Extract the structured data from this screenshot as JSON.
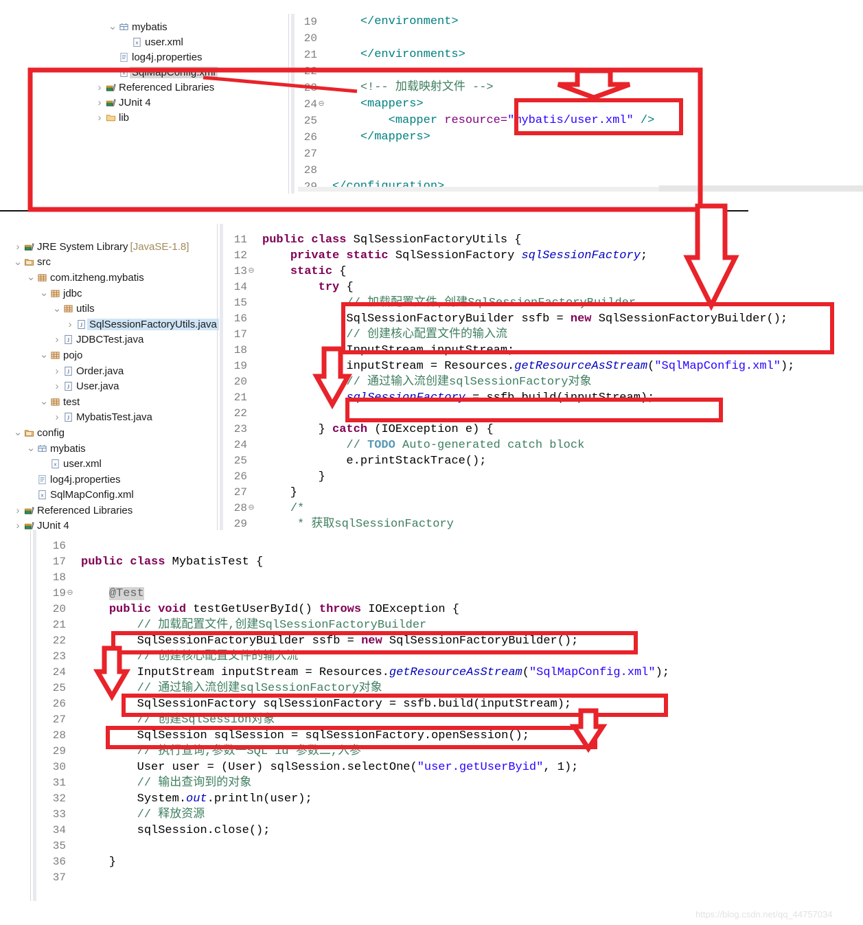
{
  "watermark": "https://blog.csdn.net/qq_44757034",
  "accent_red": "#e8232a",
  "panels": {
    "top": {
      "tree": [
        {
          "indent": 3,
          "twist": "v",
          "icon": "package-folder-icon",
          "label": "mybatis",
          "state": "none"
        },
        {
          "indent": 4,
          "twist": "",
          "icon": "xml-file-icon",
          "label": "user.xml",
          "state": "none"
        },
        {
          "indent": 3,
          "twist": "",
          "icon": "properties-file-icon",
          "label": "log4j.properties",
          "state": "none"
        },
        {
          "indent": 3,
          "twist": "",
          "icon": "xml-file-icon",
          "label": "SqlMapConfig.xml",
          "state": "selected-gray"
        },
        {
          "indent": 2,
          "twist": ">",
          "icon": "library-icon",
          "label": "Referenced Libraries",
          "state": "none"
        },
        {
          "indent": 2,
          "twist": ">",
          "icon": "library-icon",
          "label": "JUnit 4",
          "state": "none"
        },
        {
          "indent": 2,
          "twist": ">",
          "icon": "folder-icon",
          "label": "lib",
          "state": "none"
        }
      ],
      "code": [
        {
          "n": "19",
          "fold": "",
          "tokens": [
            {
              "t": "    ",
              "c": "plain"
            },
            {
              "t": "</environment>",
              "c": "tag"
            }
          ]
        },
        {
          "n": "20",
          "fold": "",
          "tokens": []
        },
        {
          "n": "21",
          "fold": "",
          "tokens": [
            {
              "t": "    ",
              "c": "plain"
            },
            {
              "t": "</environments>",
              "c": "tag"
            }
          ]
        },
        {
          "n": "22",
          "fold": "",
          "tokens": []
        },
        {
          "n": "23",
          "fold": "",
          "tokens": [
            {
              "t": "    ",
              "c": "plain"
            },
            {
              "t": "<!-- 加载映射文件 -->",
              "c": "cmt"
            }
          ]
        },
        {
          "n": "24",
          "fold": "⊖",
          "tokens": [
            {
              "t": "    ",
              "c": "plain"
            },
            {
              "t": "<mappers>",
              "c": "tag"
            }
          ]
        },
        {
          "n": "25",
          "fold": "",
          "tokens": [
            {
              "t": "        ",
              "c": "plain"
            },
            {
              "t": "<mapper ",
              "c": "tag"
            },
            {
              "t": "resource=",
              "c": "attr"
            },
            {
              "t": "\"mybatis/user.xml\"",
              "c": "str"
            },
            {
              "t": " />",
              "c": "tag"
            }
          ]
        },
        {
          "n": "26",
          "fold": "",
          "tokens": [
            {
              "t": "    ",
              "c": "plain"
            },
            {
              "t": "</mappers>",
              "c": "tag"
            }
          ]
        },
        {
          "n": "27",
          "fold": "",
          "tokens": []
        },
        {
          "n": "28",
          "fold": "",
          "tokens": []
        },
        {
          "n": "29",
          "fold": "",
          "tokens": [
            {
              "t": "</configuration>",
              "c": "tag"
            }
          ]
        }
      ]
    },
    "middle": {
      "tree": [
        {
          "indent": 1,
          "twist": ">",
          "icon": "library-icon",
          "label": "JRE System Library ",
          "suffix": "[JavaSE-1.8]",
          "state": "none"
        },
        {
          "indent": 1,
          "twist": "v",
          "icon": "source-folder-icon",
          "label": "src",
          "state": "none"
        },
        {
          "indent": 2,
          "twist": "v",
          "icon": "package-icon",
          "label": "com.itzheng.mybatis",
          "state": "none"
        },
        {
          "indent": 3,
          "twist": "v",
          "icon": "package-icon",
          "label": "jdbc",
          "state": "none"
        },
        {
          "indent": 4,
          "twist": "v",
          "icon": "package-icon",
          "label": "utils",
          "state": "none"
        },
        {
          "indent": 5,
          "twist": ">",
          "icon": "java-file-icon",
          "label": "SqlSessionFactoryUtils.java",
          "state": "selected-blue"
        },
        {
          "indent": 4,
          "twist": ">",
          "icon": "java-file-icon",
          "label": "JDBCTest.java",
          "state": "none"
        },
        {
          "indent": 3,
          "twist": "v",
          "icon": "package-icon",
          "label": "pojo",
          "state": "none"
        },
        {
          "indent": 4,
          "twist": ">",
          "icon": "java-file-icon",
          "label": "Order.java",
          "state": "none"
        },
        {
          "indent": 4,
          "twist": ">",
          "icon": "java-file-icon",
          "label": "User.java",
          "state": "none"
        },
        {
          "indent": 3,
          "twist": "v",
          "icon": "package-icon",
          "label": "test",
          "state": "none"
        },
        {
          "indent": 4,
          "twist": ">",
          "icon": "java-file-icon",
          "label": "MybatisTest.java",
          "state": "none"
        },
        {
          "indent": 1,
          "twist": "v",
          "icon": "source-folder-icon",
          "label": "config",
          "state": "none"
        },
        {
          "indent": 2,
          "twist": "v",
          "icon": "package-folder-icon",
          "label": "mybatis",
          "state": "none"
        },
        {
          "indent": 3,
          "twist": "",
          "icon": "xml-file-icon",
          "label": "user.xml",
          "state": "none"
        },
        {
          "indent": 2,
          "twist": "",
          "icon": "properties-file-icon",
          "label": "log4j.properties",
          "state": "none"
        },
        {
          "indent": 2,
          "twist": "",
          "icon": "xml-file-icon",
          "label": "SqlMapConfig.xml",
          "state": "none"
        },
        {
          "indent": 1,
          "twist": ">",
          "icon": "library-icon",
          "label": "Referenced Libraries",
          "state": "none"
        },
        {
          "indent": 1,
          "twist": ">",
          "icon": "library-icon",
          "label": "JUnit 4",
          "state": "none"
        }
      ],
      "code": [
        {
          "n": "11",
          "fold": "",
          "tokens": [
            {
              "t": "public class ",
              "c": "kw"
            },
            {
              "t": "SqlSessionFactoryUtils",
              "c": "plain"
            },
            {
              "t": " {",
              "c": "plain"
            }
          ]
        },
        {
          "n": "12",
          "fold": "",
          "tokens": [
            {
              "t": "    ",
              "c": "plain"
            },
            {
              "t": "private static ",
              "c": "kw"
            },
            {
              "t": "SqlSessionFactory ",
              "c": "plain"
            },
            {
              "t": "sqlSessionFactory",
              "c": "stat"
            },
            {
              "t": ";",
              "c": "plain"
            }
          ]
        },
        {
          "n": "13",
          "fold": "⊖",
          "tokens": [
            {
              "t": "    ",
              "c": "plain"
            },
            {
              "t": "static ",
              "c": "kw"
            },
            {
              "t": "{",
              "c": "plain"
            }
          ]
        },
        {
          "n": "14",
          "fold": "",
          "tokens": [
            {
              "t": "        ",
              "c": "plain"
            },
            {
              "t": "try ",
              "c": "kw"
            },
            {
              "t": "{",
              "c": "plain"
            }
          ]
        },
        {
          "n": "15",
          "fold": "",
          "tokens": [
            {
              "t": "            // 加载配置文件,创建SqlSessionFactoryBuilder",
              "c": "cmt"
            }
          ]
        },
        {
          "n": "16",
          "fold": "",
          "tokens": [
            {
              "t": "            ",
              "c": "plain"
            },
            {
              "t": "SqlSessionFactoryBuilder ssfb = ",
              "c": "plain"
            },
            {
              "t": "new ",
              "c": "kw"
            },
            {
              "t": "SqlSessionFactoryBuilder();",
              "c": "plain"
            }
          ]
        },
        {
          "n": "17",
          "fold": "",
          "tokens": [
            {
              "t": "            // 创建核心配置文件的输入流",
              "c": "cmt"
            }
          ]
        },
        {
          "n": "18",
          "fold": "",
          "tokens": [
            {
              "t": "            ",
              "c": "plain"
            },
            {
              "t": "InputStream inputStream;",
              "c": "plain"
            }
          ]
        },
        {
          "n": "19",
          "fold": "",
          "tokens": [
            {
              "t": "            ",
              "c": "plain"
            },
            {
              "t": "inputStream = Resources.",
              "c": "plain"
            },
            {
              "t": "getResourceAsStream",
              "c": "stat"
            },
            {
              "t": "(",
              "c": "plain"
            },
            {
              "t": "\"SqlMapConfig.xml\"",
              "c": "str"
            },
            {
              "t": ");",
              "c": "plain"
            }
          ]
        },
        {
          "n": "20",
          "fold": "",
          "tokens": [
            {
              "t": "            // 通过输入流创建sqlSessionFactory对象",
              "c": "cmt"
            }
          ]
        },
        {
          "n": "21",
          "fold": "",
          "tokens": [
            {
              "t": "            ",
              "c": "plain"
            },
            {
              "t": "sqlSessionFactory",
              "c": "stat"
            },
            {
              "t": " = ssfb.build(inputStream);",
              "c": "plain"
            }
          ]
        },
        {
          "n": "22",
          "fold": "",
          "tokens": []
        },
        {
          "n": "23",
          "fold": "",
          "tokens": [
            {
              "t": "        } ",
              "c": "plain"
            },
            {
              "t": "catch ",
              "c": "kw"
            },
            {
              "t": "(IOException e) {",
              "c": "plain"
            }
          ]
        },
        {
          "n": "24",
          "fold": "",
          "tokens": [
            {
              "t": "            ",
              "c": "plain"
            },
            {
              "t": "// ",
              "c": "cmt"
            },
            {
              "t": "TODO",
              "c": "todo"
            },
            {
              "t": " Auto-generated catch block",
              "c": "cmt"
            }
          ]
        },
        {
          "n": "25",
          "fold": "",
          "tokens": [
            {
              "t": "            ",
              "c": "plain"
            },
            {
              "t": "e.printStackTrace();",
              "c": "plain"
            }
          ]
        },
        {
          "n": "26",
          "fold": "",
          "tokens": [
            {
              "t": "        }",
              "c": "plain"
            }
          ]
        },
        {
          "n": "27",
          "fold": "",
          "tokens": [
            {
              "t": "    }",
              "c": "plain"
            }
          ]
        },
        {
          "n": "28",
          "fold": "⊖",
          "tokens": [
            {
              "t": "    ",
              "c": "plain"
            },
            {
              "t": "/*",
              "c": "cmt"
            }
          ]
        },
        {
          "n": "29",
          "fold": "",
          "tokens": [
            {
              "t": "     * 获取sqlSessionFactory",
              "c": "cmt"
            }
          ]
        }
      ]
    },
    "bottom": {
      "code": [
        {
          "n": "16",
          "fold": "",
          "tokens": []
        },
        {
          "n": "17",
          "fold": "",
          "tokens": [
            {
              "t": "public class ",
              "c": "kw"
            },
            {
              "t": "MybatisTest",
              "c": "plain"
            },
            {
              "t": " {",
              "c": "plain"
            }
          ]
        },
        {
          "n": "18",
          "fold": "",
          "tokens": []
        },
        {
          "n": "19",
          "fold": "⊖",
          "tokens": [
            {
              "t": "    ",
              "c": "plain"
            },
            {
              "t": "@Test",
              "c": "anno"
            }
          ]
        },
        {
          "n": "20",
          "fold": "",
          "tokens": [
            {
              "t": "    ",
              "c": "plain"
            },
            {
              "t": "public void ",
              "c": "kw"
            },
            {
              "t": "testGetUserById",
              "c": "plain"
            },
            {
              "t": "() ",
              "c": "plain"
            },
            {
              "t": "throws ",
              "c": "kw"
            },
            {
              "t": "IOException {",
              "c": "plain"
            }
          ]
        },
        {
          "n": "21",
          "fold": "",
          "tokens": [
            {
              "t": "        // 加载配置文件,创建SqlSessionFactoryBuilder",
              "c": "cmt"
            }
          ]
        },
        {
          "n": "22",
          "fold": "",
          "tokens": [
            {
              "t": "        ",
              "c": "plain"
            },
            {
              "t": "SqlSessionFactoryBuilder ssfb = ",
              "c": "plain"
            },
            {
              "t": "new ",
              "c": "kw"
            },
            {
              "t": "SqlSessionFactoryBuilder();",
              "c": "plain"
            }
          ]
        },
        {
          "n": "23",
          "fold": "",
          "tokens": [
            {
              "t": "        // 创建核心配置文件的输入流",
              "c": "cmt"
            }
          ]
        },
        {
          "n": "24",
          "fold": "",
          "tokens": [
            {
              "t": "        ",
              "c": "plain"
            },
            {
              "t": "InputStream inputStream = Resources.",
              "c": "plain"
            },
            {
              "t": "getResourceAsStream",
              "c": "stat"
            },
            {
              "t": "(",
              "c": "plain"
            },
            {
              "t": "\"SqlMapConfig.xml\"",
              "c": "str"
            },
            {
              "t": ");",
              "c": "plain"
            }
          ]
        },
        {
          "n": "25",
          "fold": "",
          "tokens": [
            {
              "t": "        // 通过输入流创建sqlSessionFactory对象",
              "c": "cmt"
            }
          ]
        },
        {
          "n": "26",
          "fold": "",
          "tokens": [
            {
              "t": "        ",
              "c": "plain"
            },
            {
              "t": "SqlSessionFactory sqlSessionFactory = ssfb.build(inputStream);",
              "c": "plain"
            }
          ]
        },
        {
          "n": "27",
          "fold": "",
          "tokens": [
            {
              "t": "        // 创建SqlSession对象",
              "c": "cmt"
            }
          ]
        },
        {
          "n": "28",
          "fold": "",
          "tokens": [
            {
              "t": "        ",
              "c": "plain"
            },
            {
              "t": "SqlSession sqlSession = sqlSessionFactory.openSession();",
              "c": "plain"
            }
          ]
        },
        {
          "n": "29",
          "fold": "",
          "tokens": [
            {
              "t": "        // 执行查询,参数一SQL id 参数二,入参",
              "c": "cmt"
            }
          ]
        },
        {
          "n": "30",
          "fold": "",
          "tokens": [
            {
              "t": "        ",
              "c": "plain"
            },
            {
              "t": "User user = (User) sqlSession.selectOne(",
              "c": "plain"
            },
            {
              "t": "\"user.getUserByid\"",
              "c": "str"
            },
            {
              "t": ", 1);",
              "c": "plain"
            }
          ]
        },
        {
          "n": "31",
          "fold": "",
          "tokens": [
            {
              "t": "        // 输出查询到的对象",
              "c": "cmt"
            }
          ]
        },
        {
          "n": "32",
          "fold": "",
          "tokens": [
            {
              "t": "        ",
              "c": "plain"
            },
            {
              "t": "System.",
              "c": "plain"
            },
            {
              "t": "out",
              "c": "stat"
            },
            {
              "t": ".println(user);",
              "c": "plain"
            }
          ]
        },
        {
          "n": "33",
          "fold": "",
          "tokens": [
            {
              "t": "        // 释放资源",
              "c": "cmt"
            }
          ]
        },
        {
          "n": "34",
          "fold": "",
          "tokens": [
            {
              "t": "        ",
              "c": "plain"
            },
            {
              "t": "sqlSession.close();",
              "c": "plain"
            }
          ]
        },
        {
          "n": "35",
          "fold": "",
          "tokens": []
        },
        {
          "n": "36",
          "fold": "",
          "tokens": [
            {
              "t": "    }",
              "c": "plain"
            }
          ]
        },
        {
          "n": "37",
          "fold": "",
          "tokens": []
        }
      ]
    }
  }
}
